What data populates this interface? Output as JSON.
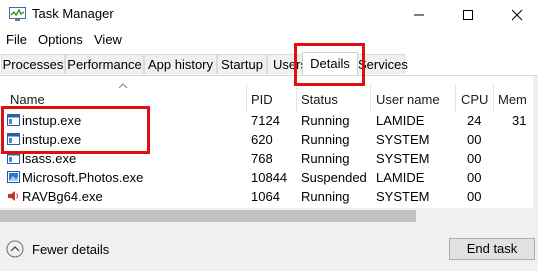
{
  "window": {
    "title": "Task Manager"
  },
  "menu": [
    "File",
    "Options",
    "View"
  ],
  "tabs": [
    "Processes",
    "Performance",
    "App history",
    "Startup",
    "Users",
    "Details",
    "Services"
  ],
  "active_tab": "Details",
  "columns": [
    "Name",
    "PID",
    "Status",
    "User name",
    "CPU",
    "Mem"
  ],
  "rows": [
    {
      "name": "instup.exe",
      "pid": "7124",
      "status": "Running",
      "user": "LAMIDE",
      "cpu": "24",
      "mem": "31",
      "icon": "app-window-icon"
    },
    {
      "name": "instup.exe",
      "pid": "620",
      "status": "Running",
      "user": "SYSTEM",
      "cpu": "00",
      "mem": "",
      "icon": "app-window-icon"
    },
    {
      "name": "lsass.exe",
      "pid": "768",
      "status": "Running",
      "user": "SYSTEM",
      "cpu": "00",
      "mem": "",
      "icon": "app-window-icon"
    },
    {
      "name": "Microsoft.Photos.exe",
      "pid": "10844",
      "status": "Suspended",
      "user": "LAMIDE",
      "cpu": "00",
      "mem": "",
      "icon": "photos-icon"
    },
    {
      "name": "RAVBg64.exe",
      "pid": "1064",
      "status": "Running",
      "user": "SYSTEM",
      "cpu": "00",
      "mem": "",
      "icon": "speaker-icon"
    }
  ],
  "footer": {
    "fewer_details": "Fewer details",
    "end_task": "End task"
  },
  "colors": {
    "highlight": "#e01010",
    "footer_bg": "#f0f0f0"
  }
}
